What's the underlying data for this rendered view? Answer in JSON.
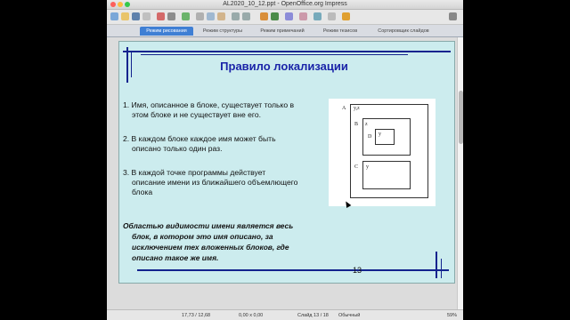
{
  "window": {
    "title": "AL2020_10_12.ppt - OpenOffice.org Impress"
  },
  "tabs": [
    "Режим рисования",
    "Режим структуры",
    "Режим примечаний",
    "Режим тезисов",
    "Сортировщик слайдов"
  ],
  "slide": {
    "title": "Правило локализации",
    "items": [
      [
        "1. Имя, описанное в блоке, существует только в",
        "этом блоке и не существует вне его."
      ],
      [
        "2. В каждом блоке каждое имя может быть",
        "описано только один раз."
      ],
      [
        "3. В каждой точке программы действует",
        "описание имени из ближайшего объемлющего",
        "блока"
      ]
    ],
    "note": [
      "Областью видимости имени является весь",
      "блок, в котором это имя описано, за",
      "исключением тех вложенных блоков, где",
      "описано такое же имя."
    ],
    "page_number": "13",
    "diagram": {
      "a": "A",
      "a_vars": "y,z",
      "b": "B",
      "b_vars": "z",
      "d": "D",
      "d_vars": "y",
      "c": "C",
      "c_vars": "y"
    }
  },
  "status": {
    "position": "17,73 / 12,68",
    "size": "0,00 x 0,00",
    "slide": "Слайд 13 / 18",
    "layout": "Обычный",
    "zoom": "59%"
  },
  "colors": {
    "slide_bg": "#ccecee",
    "title": "#1a24a8",
    "frame": "#13238e",
    "active_tab": "#3f7fd4"
  }
}
